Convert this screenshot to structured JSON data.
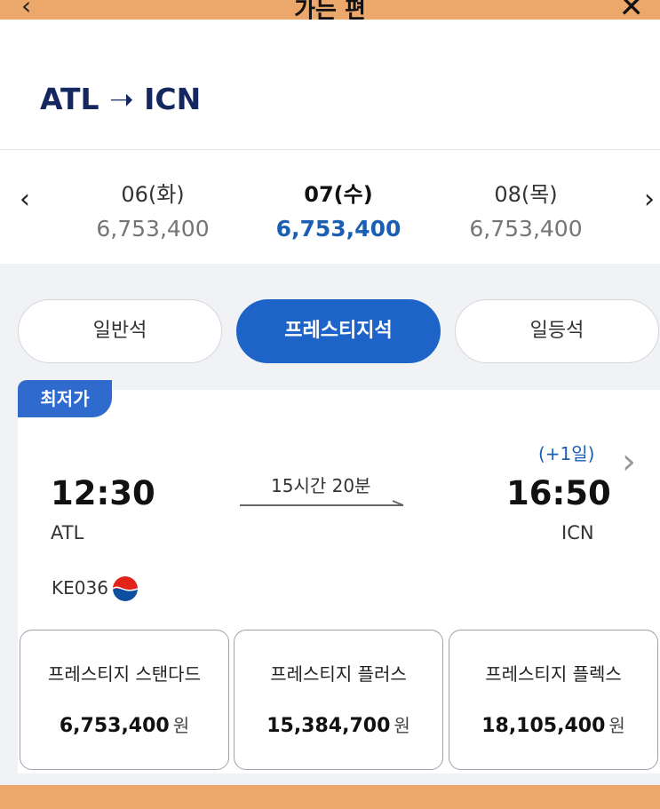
{
  "header": {
    "back_icon": "‹",
    "title": "가는 편",
    "close_icon": "✕"
  },
  "route": {
    "text": "ATL ➝ ICN",
    "origin": "ATL",
    "destination": "ICN"
  },
  "dates": {
    "items": [
      {
        "day": "06(화)",
        "price": "6,753,400"
      },
      {
        "day": "07(수)",
        "price": "6,753,400"
      },
      {
        "day": "08(목)",
        "price": "6,753,400"
      }
    ],
    "selected_index": 1
  },
  "tabs": [
    {
      "label": "일반석"
    },
    {
      "label": "프레스티지석"
    },
    {
      "label": "일등석"
    }
  ],
  "active_tab": 1,
  "flight": {
    "badge": "최저가",
    "departure_time": "12:30",
    "arrival_time": "16:50",
    "departure_code": "ATL",
    "arrival_code": "ICN",
    "duration": "15시간 20분",
    "day_offset": "(+1일)",
    "flight_number": "KE036"
  },
  "fares": [
    {
      "name": "프레스티지 스탠다드",
      "price": "6,753,400",
      "currency": "원"
    },
    {
      "name": "프레스티지 플러스",
      "price": "15,384,700",
      "currency": "원"
    },
    {
      "name": "프레스티지 플렉스",
      "price": "18,105,400",
      "currency": "원"
    }
  ],
  "colors": {
    "accent": "#1e64c8",
    "bar": "#eba86a",
    "price_selected": "#1b5fb3"
  }
}
